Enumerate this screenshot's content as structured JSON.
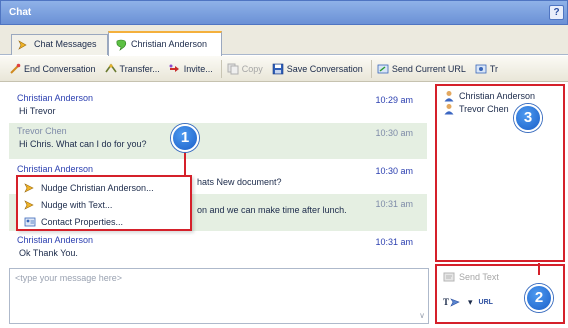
{
  "window": {
    "title": "Chat",
    "help_label": "?"
  },
  "tabs": [
    {
      "label": "Chat Messages",
      "icon": "nudge-arrow-icon",
      "active": false
    },
    {
      "label": "Christian Anderson",
      "icon": "green-chat-bubble-icon",
      "active": true
    }
  ],
  "toolbar": {
    "end_conversation": "End Conversation",
    "transfer": "Transfer...",
    "invite": "Invite...",
    "copy": "Copy",
    "save_conversation": "Save Conversation",
    "send_current_url": "Send Current URL",
    "overflow": "Tr"
  },
  "messages": [
    {
      "sender": "Christian Anderson",
      "time": "10:29 am",
      "text": "Hi Trevor",
      "alt": false
    },
    {
      "sender": "Trevor Chen",
      "time": "10:30 am",
      "text": "Hi Chris. What can I do for you?",
      "alt": true
    },
    {
      "sender": "Christian Anderson",
      "time": "10:30 am",
      "text": "hats New document?",
      "alt": false
    },
    {
      "sender": "",
      "time": "10:31 am",
      "text": "on and we can make time after lunch.",
      "alt": true
    },
    {
      "sender": "Christian Anderson",
      "time": "10:31 am",
      "text": "Ok Thank You.",
      "alt": false
    }
  ],
  "participants": [
    "Christian Anderson",
    "Trevor Chen"
  ],
  "compose": {
    "placeholder": "<type your message here>"
  },
  "send_panel": {
    "send_label": "Send Text",
    "format_label": "T",
    "url_label": "URL"
  },
  "context_menu": {
    "items": [
      "Nudge Christian Anderson...",
      "Nudge with Text...",
      "Contact Properties..."
    ]
  },
  "callouts": [
    "1",
    "2",
    "3"
  ],
  "colors": {
    "accent_red": "#d5202a",
    "callout_blue": "#1b5fc8",
    "title_blue": "#6b91d6",
    "sender_blue": "#2b3fb0"
  }
}
